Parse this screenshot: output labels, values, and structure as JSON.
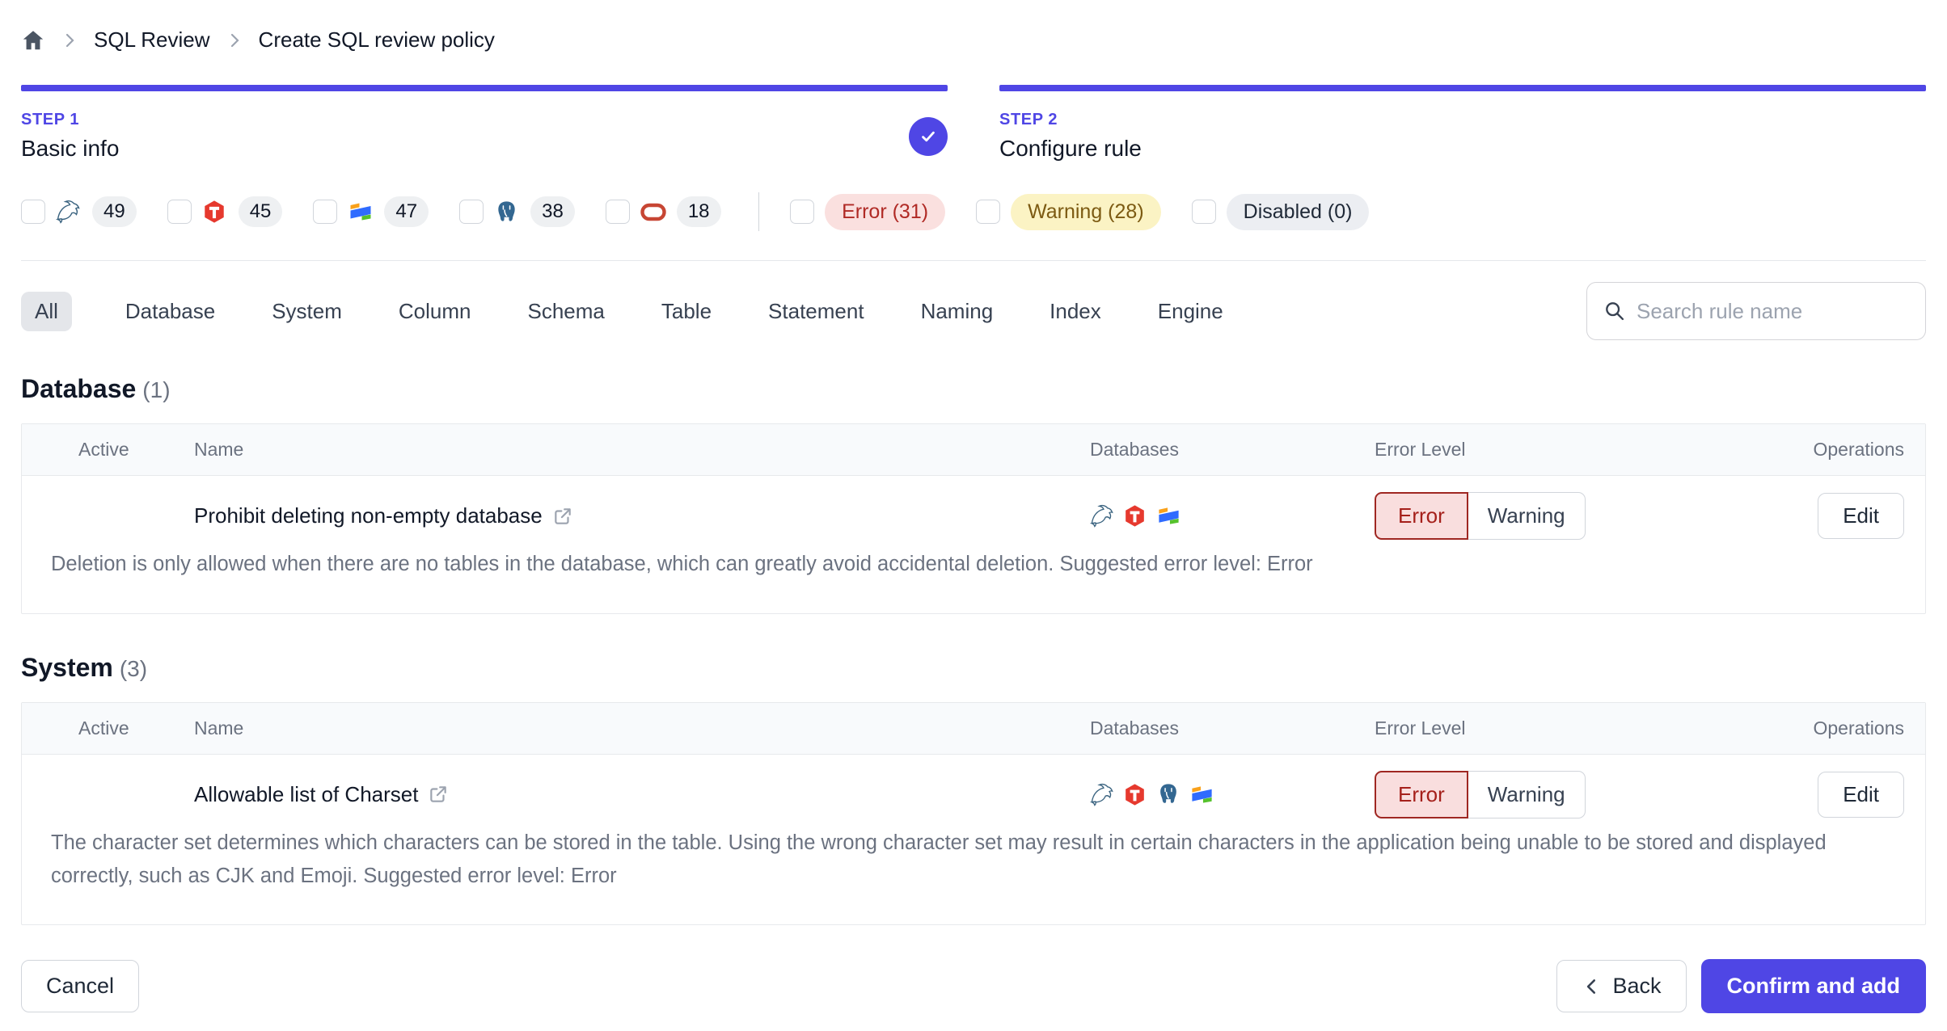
{
  "breadcrumb": {
    "items": [
      {
        "label": "SQL Review"
      },
      {
        "label": "Create SQL review policy"
      }
    ]
  },
  "steps": [
    {
      "label": "STEP 1",
      "title": "Basic info",
      "completed": true
    },
    {
      "label": "STEP 2",
      "title": "Configure rule",
      "completed": false
    }
  ],
  "filters": {
    "engines": [
      {
        "engine": "mysql",
        "count": "49"
      },
      {
        "engine": "tidb",
        "count": "45"
      },
      {
        "engine": "oceanbase",
        "count": "47"
      },
      {
        "engine": "postgresql",
        "count": "38"
      },
      {
        "engine": "oracle",
        "count": "18"
      }
    ],
    "levels": [
      {
        "label": "Error (31)",
        "type": "error"
      },
      {
        "label": "Warning (28)",
        "type": "warning"
      },
      {
        "label": "Disabled (0)",
        "type": "disabled"
      }
    ]
  },
  "tabs": {
    "active": "All",
    "items": [
      "All",
      "Database",
      "System",
      "Column",
      "Schema",
      "Table",
      "Statement",
      "Naming",
      "Index",
      "Engine"
    ]
  },
  "search": {
    "placeholder": "Search rule name"
  },
  "table_columns": [
    "Active",
    "Name",
    "Databases",
    "Error Level",
    "Operations"
  ],
  "row_actions": {
    "error": "Error",
    "warning": "Warning",
    "edit": "Edit"
  },
  "sections": [
    {
      "title": "Database",
      "count": "(1)",
      "rules": [
        {
          "name": "Prohibit deleting non-empty database",
          "active": true,
          "engines": [
            "mysql",
            "tidb",
            "oceanbase"
          ],
          "level": "Error",
          "description": "Deletion is only allowed when there are no tables in the database, which can greatly avoid accidental deletion. Suggested error level: Error"
        }
      ]
    },
    {
      "title": "System",
      "count": "(3)",
      "rules": [
        {
          "name": "Allowable list of Charset",
          "active": true,
          "engines": [
            "mysql",
            "tidb",
            "postgresql",
            "oceanbase"
          ],
          "level": "Error",
          "description": "The character set determines which characters can be stored in the table. Using the wrong character set may result in certain characters in the application being unable to be stored and displayed correctly, such as CJK and Emoji. Suggested error level: Error"
        }
      ]
    }
  ],
  "footer": {
    "cancel": "Cancel",
    "back": "Back",
    "confirm": "Confirm and add"
  },
  "colors": {
    "accent": "#4f46e5",
    "error_text": "#b02a25",
    "error_bg": "#fae0df",
    "warning_text": "#7c5a12",
    "warning_bg": "#fbf3c4",
    "disabled_bg": "#eceef2",
    "border": "#e5e7eb"
  }
}
